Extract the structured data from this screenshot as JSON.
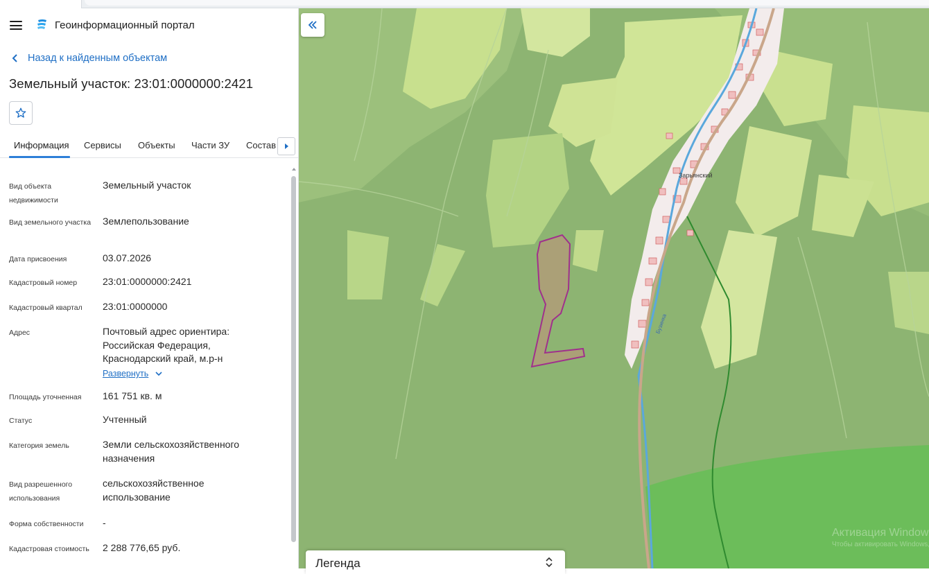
{
  "app": {
    "title": "Геоинформационный портал"
  },
  "nav": {
    "back_label": "Назад к найденным объектам"
  },
  "object": {
    "title": "Земельный участок: 23:01:0000000:2421"
  },
  "tabs": [
    {
      "label": "Информация",
      "active": true
    },
    {
      "label": "Сервисы"
    },
    {
      "label": "Объекты"
    },
    {
      "label": "Части ЗУ"
    },
    {
      "label": "Состав"
    }
  ],
  "info": {
    "rows": [
      {
        "label": "Вид объекта недвижимости",
        "value": "Земельный участок"
      },
      {
        "label": "Вид земельного участка",
        "value": "Землепользование"
      },
      {
        "label": "Дата присвоения",
        "value": "03.07.2026"
      },
      {
        "label": "Кадастровый номер",
        "value": "23:01:0000000:2421"
      },
      {
        "label": "Кадастровый квартал",
        "value": "23:01:0000000"
      },
      {
        "label": "Адрес",
        "value": "Почтовый адрес ориентира: Российская Федерация, Краснодарский край, м.р-н",
        "expand_label": "Развернуть"
      },
      {
        "label": "Площадь уточненная",
        "value": "161 751 кв. м"
      },
      {
        "label": "Статус",
        "value": "Учтенный"
      },
      {
        "label": "Категория земель",
        "value": "Земли сельскохозяйственного назначения"
      },
      {
        "label": "Вид разрешенного использования",
        "value": "сельскохозяйственное использование"
      },
      {
        "label": "Форма собственности",
        "value": "-"
      },
      {
        "label": "Кадастровая стоимость",
        "value": "2 288 776,65 руб."
      }
    ]
  },
  "map": {
    "settlement_label": "Зарьянский",
    "road_label": "Бузинка",
    "legend_label": "Легенда",
    "watermark": {
      "line1": "Активация Windows",
      "line2": "Чтобы активировать Windows, перейдите в раздел «Параметры»."
    },
    "colors": {
      "forest": "#8cb470",
      "meadow": "#cfe39a",
      "parcel_outline": "#a0308c",
      "parcel_fill": "#b59a7a",
      "water": "#5aa8dc",
      "protected": "#6cbd5a"
    }
  },
  "icons": {
    "menu": "hamburger-icon",
    "logo": "portal-logo-icon",
    "back": "chevron-left-icon",
    "favorite": "star-icon",
    "collapse": "double-chevron-left-icon",
    "legend_toggle": "unfold-icon"
  }
}
